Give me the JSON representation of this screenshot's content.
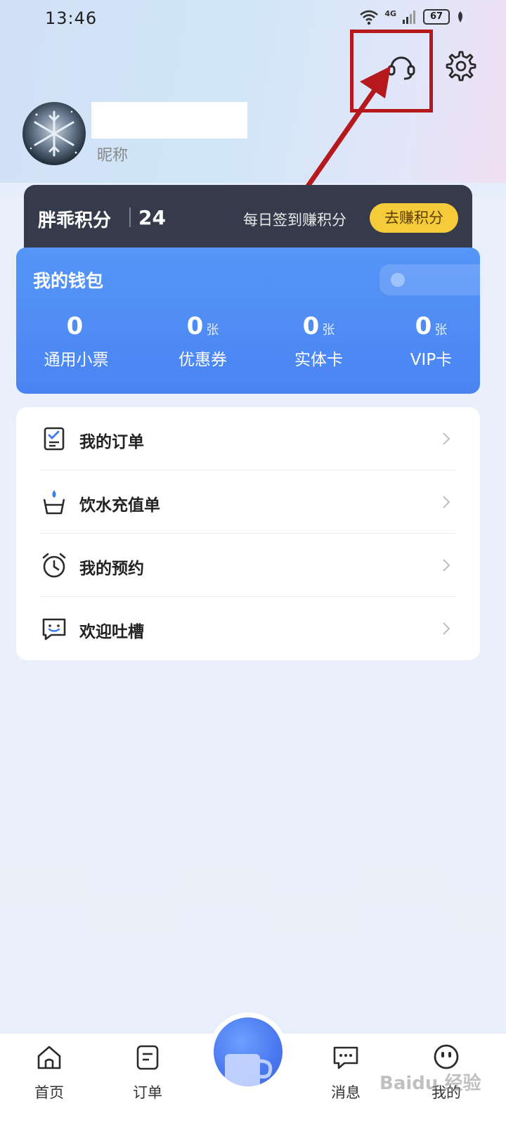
{
  "status_bar": {
    "time": "13:46",
    "network": "4G",
    "battery": "67"
  },
  "header": {
    "service_icon": "headset-icon",
    "settings_icon": "gear-icon"
  },
  "profile": {
    "nickname": "昵称"
  },
  "points": {
    "label": "胖乖积分",
    "value": "24",
    "checkin_text": "每日签到赚积分",
    "earn_button": "去赚积分"
  },
  "wallet": {
    "title": "我的钱包",
    "stats": [
      {
        "value": "0",
        "unit": "",
        "label": "通用小票"
      },
      {
        "value": "0",
        "unit": "张",
        "label": "优惠券"
      },
      {
        "value": "0",
        "unit": "张",
        "label": "实体卡"
      },
      {
        "value": "0",
        "unit": "张",
        "label": "VIP卡"
      }
    ]
  },
  "menu": [
    {
      "label": "我的订单",
      "icon": "order-checklist-icon"
    },
    {
      "label": "饮水充值单",
      "icon": "water-cup-icon"
    },
    {
      "label": "我的预约",
      "icon": "alarm-clock-icon"
    },
    {
      "label": "欢迎吐槽",
      "icon": "feedback-chat-icon"
    }
  ],
  "tabbar": [
    {
      "label": "首页",
      "icon": "home-icon"
    },
    {
      "label": "订单",
      "icon": "order-icon"
    },
    {
      "label": "",
      "icon": "cup-center-icon"
    },
    {
      "label": "消息",
      "icon": "message-icon"
    },
    {
      "label": "我的",
      "icon": "profile-face-icon"
    }
  ],
  "watermark": "Baidu 经验",
  "colors": {
    "wallet_blue": "#4a84f2",
    "points_bg": "#353b4b",
    "earn_yellow": "#f6cb3a",
    "annotation_red": "#b5191c"
  }
}
